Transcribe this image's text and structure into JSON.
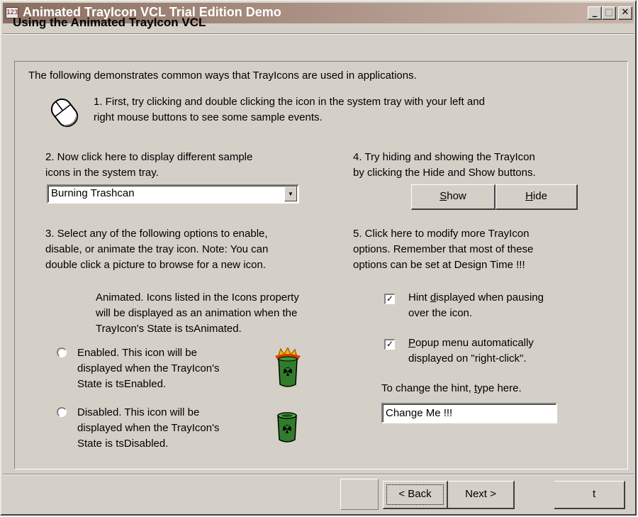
{
  "window": {
    "title": "Animated TrayIcon VCL Trial Edition Demo",
    "app_icon_glyph": "123"
  },
  "header": {
    "title": "Using the Animated TrayIcon VCL"
  },
  "intro": "The following demonstrates common ways that TrayIcons are used in applications.",
  "step1": {
    "line1": "1. First, try clicking and double clicking the icon in the system tray with your left and",
    "line2": "right mouse buttons to see some sample events."
  },
  "step2": {
    "line1": "2. Now click here to display different sample",
    "line2": "icons in the system tray.",
    "combo_value": "Burning Trashcan"
  },
  "step3": {
    "line1": "3. Select any of the following options to enable,",
    "line2": "disable, or animate the tray icon.  Note:  You can",
    "line3": "double click a picture to browse for a new icon.",
    "animated": {
      "line1": "Animated.  Icons listed in the Icons property",
      "line2": "will be displayed as an animation when the",
      "line3": "TrayIcon's State is tsAnimated."
    },
    "enabled": {
      "line1": "Enabled.  This icon will be",
      "line2": "displayed when the TrayIcon's",
      "line3": "State is tsEnabled."
    },
    "disabled": {
      "line1": "Disabled.  This icon will be",
      "line2": "displayed when the TrayIcon's",
      "line3": "State is tsDisabled."
    }
  },
  "step4": {
    "line1": "4. Try hiding and showing the TrayIcon",
    "line2": "by clicking the Hide and Show buttons.",
    "show_first": "S",
    "show_rest": "how",
    "hide_first": "H",
    "hide_rest": "ide"
  },
  "step5": {
    "line1": "5. Click here to modify more TrayIcon",
    "line2": "options.  Remember that most of these",
    "line3": "options can be set at Design Time !!!",
    "hint_check": {
      "checked": true,
      "pre": "Hint ",
      "accel": "d",
      "post": "isplayed when pausing",
      "line2": "over the icon."
    },
    "popup_check": {
      "checked": true,
      "accel": "P",
      "post": "opup menu automatically",
      "line2": "displayed on \"right-click\"."
    },
    "change_hint": {
      "pre": "To change the hint, ",
      "accel": "t",
      "post": "ype here.",
      "value": "Change Me !!!"
    }
  },
  "footer": {
    "back_label": "< Back",
    "next_label": "Next >",
    "exit_fragment": "t"
  },
  "colors": {
    "face": "#d4d0c8",
    "title_gradient_start": "#8a6f61",
    "title_gradient_end": "#c9b3a8",
    "barrel_green": "#2f7d2a",
    "flame": "#f2c200"
  }
}
